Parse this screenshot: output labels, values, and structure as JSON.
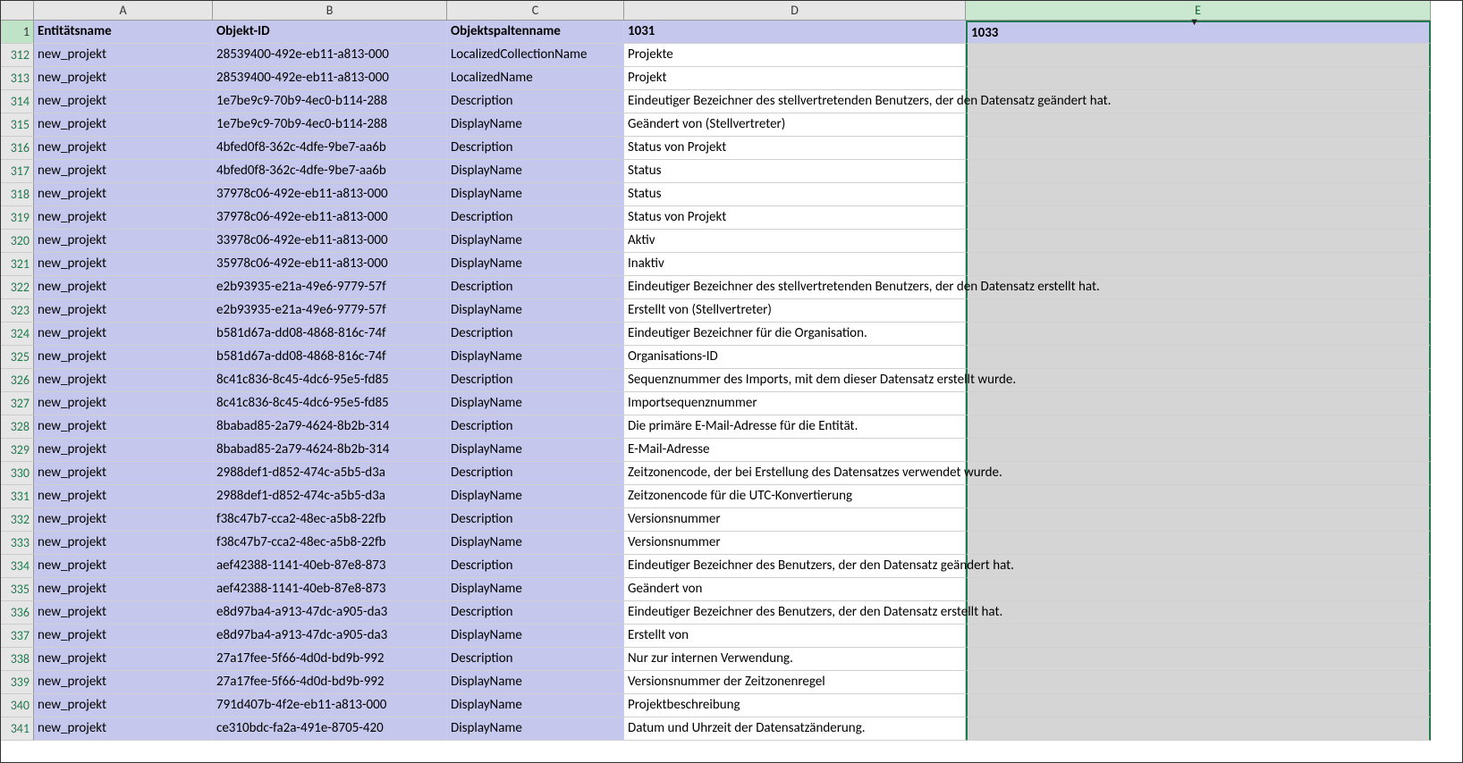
{
  "columns": [
    {
      "letter": "A",
      "width": "wA",
      "selected": false
    },
    {
      "letter": "B",
      "width": "wB",
      "selected": false
    },
    {
      "letter": "C",
      "width": "wC",
      "selected": false
    },
    {
      "letter": "D",
      "width": "wD",
      "selected": false
    },
    {
      "letter": "E",
      "width": "wE",
      "selected": true
    }
  ],
  "headerRowNum": "1",
  "headers": {
    "A": "Entitätsname",
    "B": "Objekt-ID",
    "C": "Objektspaltenname",
    "D": "1031",
    "E": "1033"
  },
  "rows": [
    {
      "n": "312",
      "A": "new_projekt",
      "B": "28539400-492e-eb11-a813-000",
      "C": "LocalizedCollectionName",
      "D": "Projekte",
      "E": ""
    },
    {
      "n": "313",
      "A": "new_projekt",
      "B": "28539400-492e-eb11-a813-000",
      "C": "LocalizedName",
      "D": "Projekt",
      "E": ""
    },
    {
      "n": "314",
      "A": "new_projekt",
      "B": "1e7be9c9-70b9-4ec0-b114-288",
      "C": "Description",
      "D": "Eindeutiger Bezeichner des stellvertretenden Benutzers, der den Datensatz geändert hat.",
      "E": ""
    },
    {
      "n": "315",
      "A": "new_projekt",
      "B": "1e7be9c9-70b9-4ec0-b114-288",
      "C": "DisplayName",
      "D": "Geändert von (Stellvertreter)",
      "E": ""
    },
    {
      "n": "316",
      "A": "new_projekt",
      "B": "4bfed0f8-362c-4dfe-9be7-aa6b",
      "C": "Description",
      "D": "Status von Projekt",
      "E": ""
    },
    {
      "n": "317",
      "A": "new_projekt",
      "B": "4bfed0f8-362c-4dfe-9be7-aa6b",
      "C": "DisplayName",
      "D": "Status",
      "E": ""
    },
    {
      "n": "318",
      "A": "new_projekt",
      "B": "37978c06-492e-eb11-a813-000",
      "C": "DisplayName",
      "D": "Status",
      "E": ""
    },
    {
      "n": "319",
      "A": "new_projekt",
      "B": "37978c06-492e-eb11-a813-000",
      "C": "Description",
      "D": "Status von Projekt",
      "E": ""
    },
    {
      "n": "320",
      "A": "new_projekt",
      "B": "33978c06-492e-eb11-a813-000",
      "C": "DisplayName",
      "D": "Aktiv",
      "E": ""
    },
    {
      "n": "321",
      "A": "new_projekt",
      "B": "35978c06-492e-eb11-a813-000",
      "C": "DisplayName",
      "D": "Inaktiv",
      "E": ""
    },
    {
      "n": "322",
      "A": "new_projekt",
      "B": "e2b93935-e21a-49e6-9779-57f",
      "C": "Description",
      "D": "Eindeutiger Bezeichner des stellvertretenden Benutzers, der den Datensatz erstellt hat.",
      "E": ""
    },
    {
      "n": "323",
      "A": "new_projekt",
      "B": "e2b93935-e21a-49e6-9779-57f",
      "C": "DisplayName",
      "D": "Erstellt von (Stellvertreter)",
      "E": ""
    },
    {
      "n": "324",
      "A": "new_projekt",
      "B": "b581d67a-dd08-4868-816c-74f",
      "C": "Description",
      "D": "Eindeutiger Bezeichner für die Organisation.",
      "E": ""
    },
    {
      "n": "325",
      "A": "new_projekt",
      "B": "b581d67a-dd08-4868-816c-74f",
      "C": "DisplayName",
      "D": "Organisations-ID",
      "E": ""
    },
    {
      "n": "326",
      "A": "new_projekt",
      "B": "8c41c836-8c45-4dc6-95e5-fd85",
      "C": "Description",
      "D": "Sequenznummer des Imports, mit dem dieser Datensatz erstellt wurde.",
      "E": ""
    },
    {
      "n": "327",
      "A": "new_projekt",
      "B": "8c41c836-8c45-4dc6-95e5-fd85",
      "C": "DisplayName",
      "D": "Importsequenznummer",
      "E": ""
    },
    {
      "n": "328",
      "A": "new_projekt",
      "B": "8babad85-2a79-4624-8b2b-314",
      "C": "Description",
      "D": "Die primäre E-Mail-Adresse für die Entität.",
      "E": ""
    },
    {
      "n": "329",
      "A": "new_projekt",
      "B": "8babad85-2a79-4624-8b2b-314",
      "C": "DisplayName",
      "D": "E-Mail-Adresse",
      "E": ""
    },
    {
      "n": "330",
      "A": "new_projekt",
      "B": "2988def1-d852-474c-a5b5-d3a",
      "C": "Description",
      "D": "Zeitzonencode, der bei Erstellung des Datensatzes verwendet wurde.",
      "E": ""
    },
    {
      "n": "331",
      "A": "new_projekt",
      "B": "2988def1-d852-474c-a5b5-d3a",
      "C": "DisplayName",
      "D": "Zeitzonencode für die UTC-Konvertierung",
      "E": ""
    },
    {
      "n": "332",
      "A": "new_projekt",
      "B": "f38c47b7-cca2-48ec-a5b8-22fb",
      "C": "Description",
      "D": "Versionsnummer",
      "E": ""
    },
    {
      "n": "333",
      "A": "new_projekt",
      "B": "f38c47b7-cca2-48ec-a5b8-22fb",
      "C": "DisplayName",
      "D": "Versionsnummer",
      "E": ""
    },
    {
      "n": "334",
      "A": "new_projekt",
      "B": "aef42388-1141-40eb-87e8-873",
      "C": "Description",
      "D": "Eindeutiger Bezeichner des Benutzers, der den Datensatz geändert hat.",
      "E": ""
    },
    {
      "n": "335",
      "A": "new_projekt",
      "B": "aef42388-1141-40eb-87e8-873",
      "C": "DisplayName",
      "D": "Geändert von",
      "E": ""
    },
    {
      "n": "336",
      "A": "new_projekt",
      "B": "e8d97ba4-a913-47dc-a905-da3",
      "C": "Description",
      "D": "Eindeutiger Bezeichner des Benutzers, der den Datensatz erstellt hat.",
      "E": ""
    },
    {
      "n": "337",
      "A": "new_projekt",
      "B": "e8d97ba4-a913-47dc-a905-da3",
      "C": "DisplayName",
      "D": "Erstellt von",
      "E": ""
    },
    {
      "n": "338",
      "A": "new_projekt",
      "B": "27a17fee-5f66-4d0d-bd9b-992",
      "C": "Description",
      "D": "Nur zur internen Verwendung.",
      "E": ""
    },
    {
      "n": "339",
      "A": "new_projekt",
      "B": "27a17fee-5f66-4d0d-bd9b-992",
      "C": "DisplayName",
      "D": "Versionsnummer der Zeitzonenregel",
      "E": ""
    },
    {
      "n": "340",
      "A": "new_projekt",
      "B": "791d407b-4f2e-eb11-a813-000",
      "C": "DisplayName",
      "D": "Projektbeschreibung",
      "E": ""
    },
    {
      "n": "341",
      "A": "new_projekt",
      "B": "ce310bdc-fa2a-491e-8705-420",
      "C": "DisplayName",
      "D": "Datum und Uhrzeit der Datensatzänderung.",
      "E": ""
    }
  ]
}
